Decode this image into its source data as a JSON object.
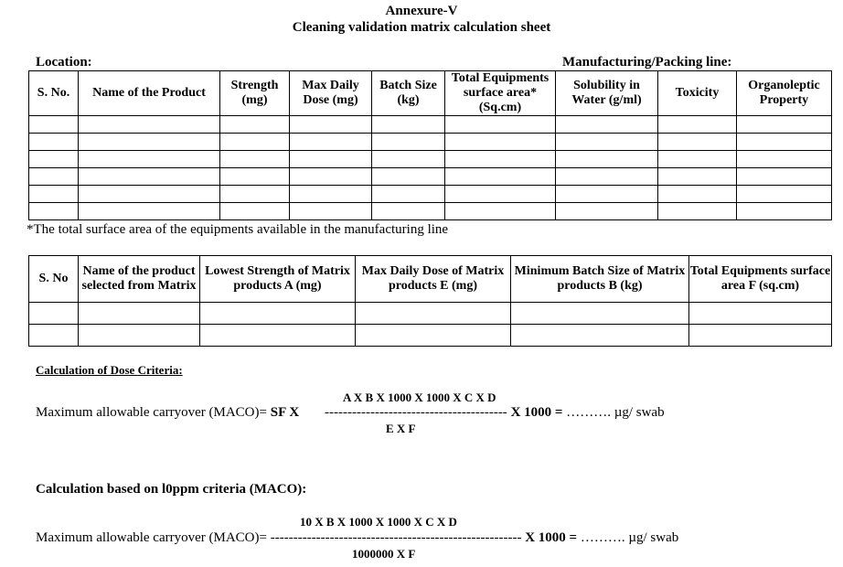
{
  "header": {
    "annexure": "Annexure-V",
    "title": "Cleaning validation matrix calculation sheet"
  },
  "labels": {
    "location": "Location:",
    "line": "Manufacturing/Packing line:"
  },
  "table1": {
    "columns": [
      "S. No.",
      "Name of the Product",
      "Strength (mg)",
      "Max Daily Dose (mg)",
      "Batch Size (kg)",
      "Total Equipments surface area* (Sq.cm)",
      "Solubility in Water (g/ml)",
      "Toxicity",
      "Organoleptic Property"
    ],
    "rows": [
      [
        "",
        "",
        "",
        "",
        "",
        "",
        "",
        "",
        ""
      ],
      [
        "",
        "",
        "",
        "",
        "",
        "",
        "",
        "",
        ""
      ],
      [
        "",
        "",
        "",
        "",
        "",
        "",
        "",
        "",
        ""
      ],
      [
        "",
        "",
        "",
        "",
        "",
        "",
        "",
        "",
        ""
      ],
      [
        "",
        "",
        "",
        "",
        "",
        "",
        "",
        "",
        ""
      ],
      [
        "",
        "",
        "",
        "",
        "",
        "",
        "",
        "",
        ""
      ]
    ],
    "footnote": "*The total surface area of the equipments available in the manufacturing line"
  },
  "table2": {
    "columns": [
      "S. No",
      "Name of the product selected from Matrix",
      "Lowest Strength of Matrix products A (mg)",
      "Max Daily Dose of Matrix products E (mg)",
      "Minimum Batch Size of Matrix products B (kg)",
      "Total Equipments surface area F (sq.cm)"
    ],
    "rows": [
      [
        "",
        "",
        "",
        "",
        "",
        ""
      ],
      [
        "",
        "",
        "",
        "",
        "",
        ""
      ]
    ]
  },
  "dose_criteria": {
    "heading": "Calculation of Dose Criteria:",
    "lhs": "Maximum allowable carryover (MACO)=",
    "sf": "SF X",
    "numerator": "A X B X 1000 X 1000 X C X D",
    "dashes": "----------------------------------------",
    "multiplier": "X 1000 =",
    "result": "………. µg/ swab",
    "denominator": "E X F"
  },
  "ppm_criteria": {
    "heading": "Calculation based on l0ppm criteria (MACO):",
    "lhs": "Maximum allowable carryover (MACO)=",
    "numerator": "10 X B X 1000 X 1000 X C X D",
    "dashes": "-------------------------------------------------------",
    "multiplier": "X 1000 =",
    "result": "………. µg/ swab",
    "denominator": "1000000 X F"
  }
}
